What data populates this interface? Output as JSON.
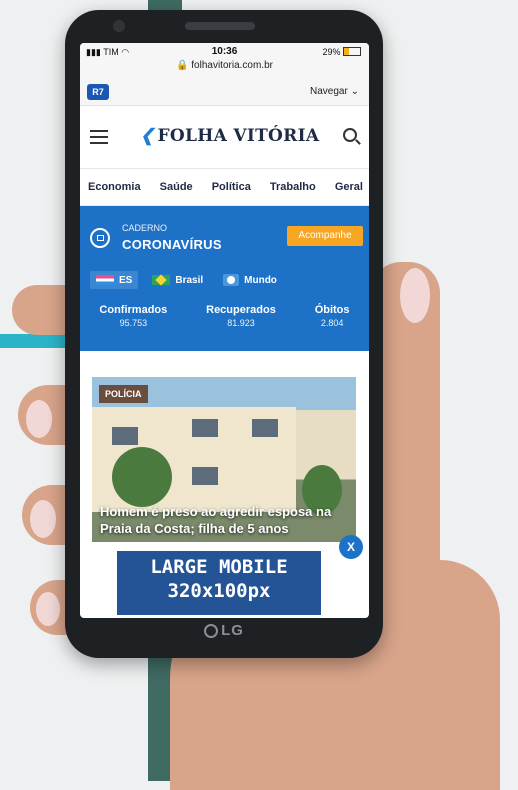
{
  "status_bar": {
    "carrier": "TIM",
    "time": "10:36",
    "battery": "29%",
    "url": "folhavitoria.com.br"
  },
  "r7_bar": {
    "logo": "R7",
    "menu_label": "Navegar"
  },
  "header": {
    "site_name": "FOLHA VITÓRIA"
  },
  "sections": [
    "Economia",
    "Saúde",
    "Política",
    "Trabalho",
    "Geral"
  ],
  "covid": {
    "label": "CADERNO",
    "title": "CORONAVÍRUS",
    "follow_label": "Acompanhe",
    "regions": [
      {
        "name": "ES",
        "active": true
      },
      {
        "name": "Brasil",
        "active": false
      },
      {
        "name": "Mundo",
        "active": false
      }
    ],
    "stats": [
      {
        "label": "Confirmados",
        "value": "95.753"
      },
      {
        "label": "Recuperados",
        "value": "81.923"
      },
      {
        "label": "Óbitos",
        "value": "2.804"
      }
    ]
  },
  "story": {
    "category": "POLÍCIA",
    "headline": "Homem é preso ao agredir esposa na Praia da Costa; filha de 5 anos"
  },
  "ad": {
    "line1": "LARGE MOBILE",
    "line2": "320x100px",
    "close_label": "X"
  },
  "device": {
    "brand": "LG"
  },
  "colors": {
    "brand_blue": "#1d72c8",
    "accent_orange": "#f6a623",
    "ad_blue": "#245495"
  }
}
